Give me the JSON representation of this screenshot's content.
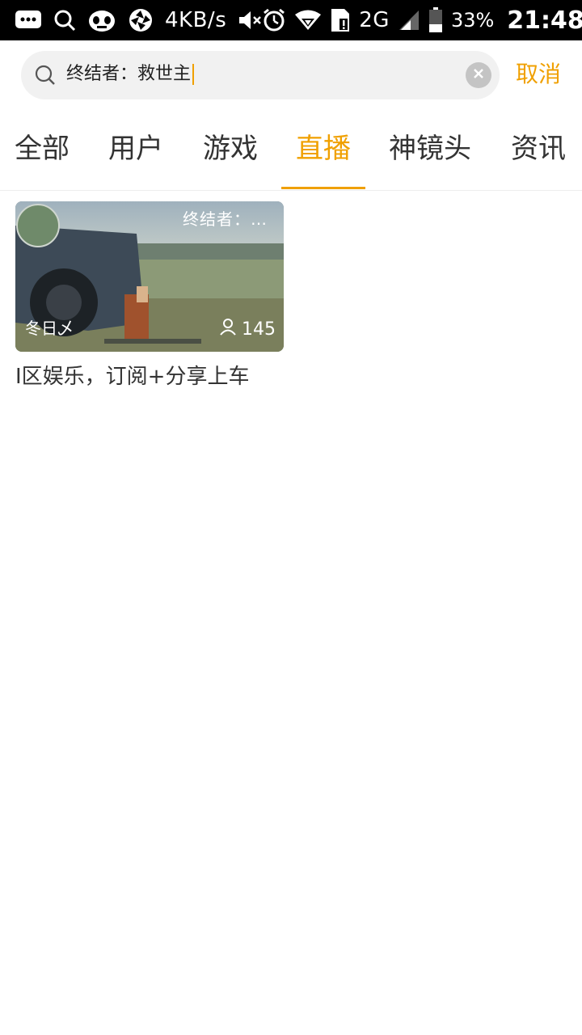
{
  "status_bar": {
    "net_speed": "4KB/s",
    "network": "2G",
    "battery": "33%",
    "time": "21:48",
    "icons": [
      "chat-bubble-icon",
      "search-icon",
      "mascot-icon",
      "aperture-icon",
      "mute-icon",
      "alarm-icon",
      "wifi-icon",
      "sim-card-icon",
      "signal-icon",
      "battery-icon"
    ]
  },
  "search": {
    "query": "终结者：救世主",
    "cancel_label": "取消",
    "icons": {
      "search": "search-icon",
      "clear": "clear-icon"
    }
  },
  "tabs": [
    {
      "label": "全部",
      "active": false
    },
    {
      "label": "用户",
      "active": false
    },
    {
      "label": "游戏",
      "active": false
    },
    {
      "label": "直播",
      "active": true
    },
    {
      "label": "神镜头",
      "active": false
    },
    {
      "label": "资讯",
      "active": false
    }
  ],
  "results": [
    {
      "overlay_title": "终结者：…",
      "streamer": "冬日乄",
      "viewers": "145",
      "title": "I区娱乐，订阅+分享上车"
    }
  ],
  "colors": {
    "accent": "#f0a000",
    "text": "#333333",
    "search_bg": "#f1f1f1"
  }
}
